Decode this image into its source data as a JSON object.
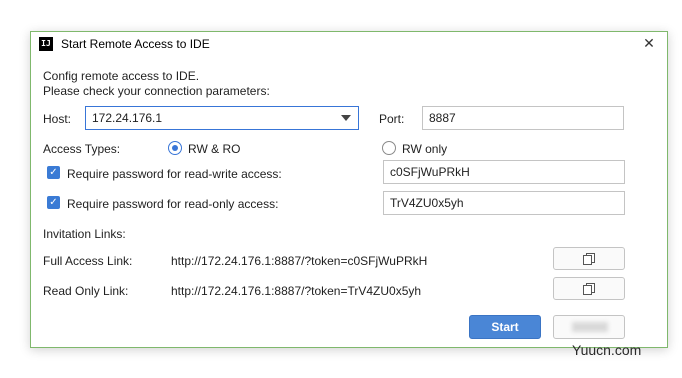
{
  "window": {
    "title": "Start Remote Access to IDE",
    "app_icon": "intellij-icon"
  },
  "intro": {
    "line1": "Config remote access to IDE.",
    "line2": "Please check your connection parameters:"
  },
  "host": {
    "label": "Host:",
    "value": "172.24.176.1"
  },
  "port": {
    "label": "Port:",
    "value": "8887"
  },
  "access_types": {
    "label": "Access Types:",
    "option_rw_ro": "RW & RO",
    "option_rw_only": "RW only",
    "selected": "RW & RO"
  },
  "passwords": {
    "rw_label": "Require password for read-write access:",
    "rw_value": "c0SFjWuPRkH",
    "ro_label": "Require password for read-only access:",
    "ro_value": "TrV4ZU0x5yh"
  },
  "invitation": {
    "heading": "Invitation Links:",
    "full_label": "Full Access Link:",
    "full_link": "http://172.24.176.1:8887/?token=c0SFjWuPRkH",
    "ro_label": "Read Only Link:",
    "ro_link": "http://172.24.176.1:8887/?token=TrV4ZU0x5yh"
  },
  "buttons": {
    "start": "Start"
  },
  "watermark": "Yuucn.com",
  "colors": {
    "accent": "#3875d7",
    "border_frame": "#7fb86c",
    "primary_button": "#4a86d6"
  }
}
